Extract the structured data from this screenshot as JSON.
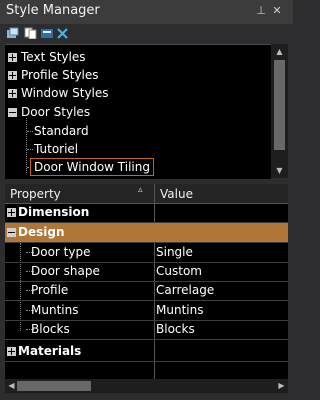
{
  "window": {
    "title": "Style Manager",
    "pin_glyph": "⊥",
    "close_glyph": "✕"
  },
  "toolbar": {
    "icons": [
      "new-style-icon",
      "copy-style-icon",
      "rename-style-icon",
      "delete-style-icon"
    ]
  },
  "tree": {
    "items": [
      {
        "label": "Text Styles",
        "expanded": false,
        "level": 0
      },
      {
        "label": "Profile Styles",
        "expanded": false,
        "level": 0
      },
      {
        "label": "Window Styles",
        "expanded": false,
        "level": 0
      },
      {
        "label": "Door Styles",
        "expanded": true,
        "level": 0
      },
      {
        "label": "Standard",
        "level": 1
      },
      {
        "label": "Tutoriel",
        "level": 1
      },
      {
        "label": "Door Window Tiling",
        "level": 1,
        "selected": true
      }
    ]
  },
  "grid": {
    "header_property": "Property",
    "header_value": "Value",
    "sort_glyph": "▵",
    "categories": {
      "dimension": "Dimension",
      "design": "Design",
      "materials": "Materials"
    },
    "design_rows": [
      {
        "property": "Door type",
        "value": "Single"
      },
      {
        "property": "Door shape",
        "value": "Custom"
      },
      {
        "property": "Profile",
        "value": "Carrelage"
      },
      {
        "property": "Muntins",
        "value": "Muntins"
      },
      {
        "property": "Blocks",
        "value": "Blocks"
      }
    ]
  },
  "colors": {
    "accent_selected": "#b07638",
    "selection_border": "#c5651c"
  }
}
